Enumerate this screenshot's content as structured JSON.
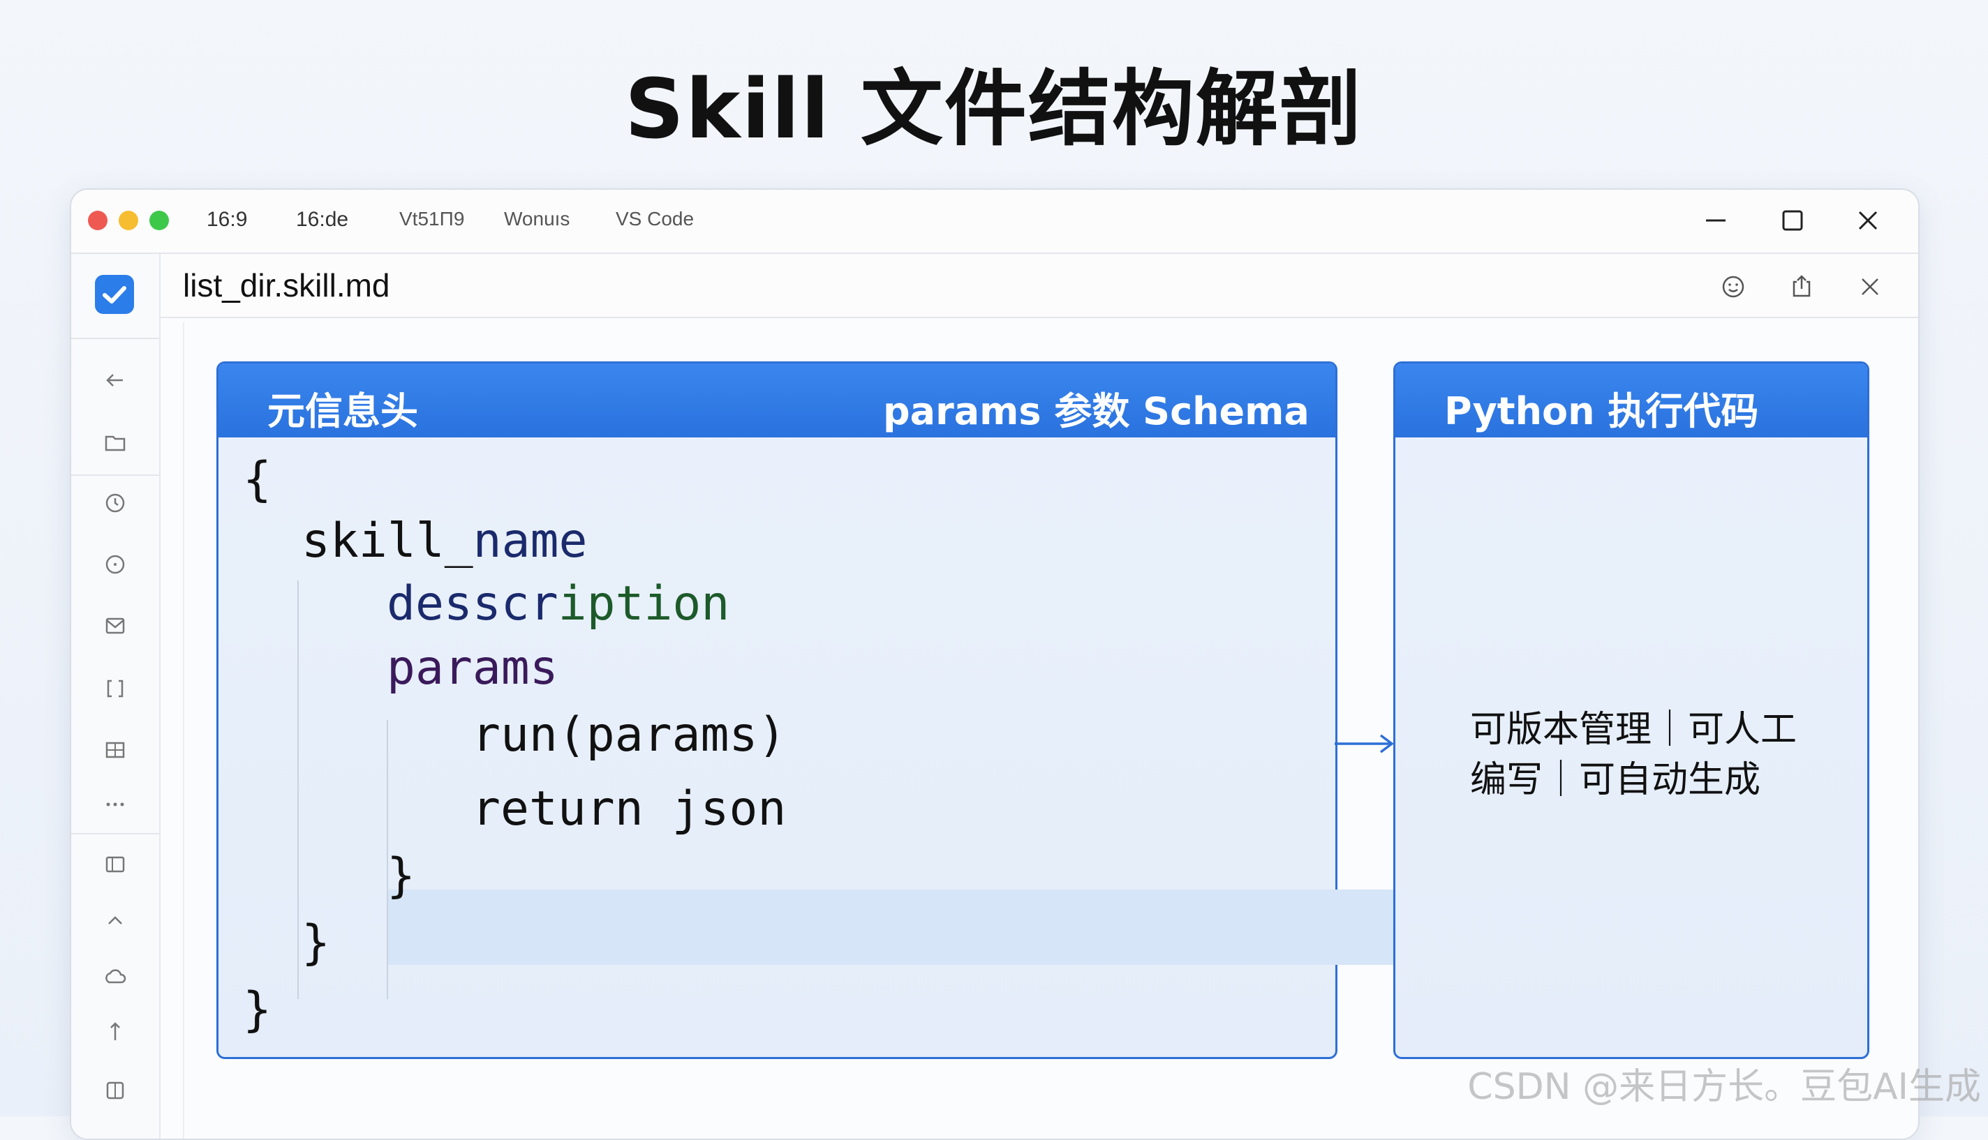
{
  "page": {
    "title": "Skill 文件结构解剖",
    "watermark": "CSDN @来日方长。豆包AI生成"
  },
  "titlebar": {
    "tabs": [
      "16:9",
      "16:de",
      "Vt51Π9",
      "Wonuıs",
      "VS Code"
    ]
  },
  "editor": {
    "file_name": "list_dir.skill.md"
  },
  "left_panel": {
    "header_left": "元信息头",
    "header_right": "params 参数 Schema",
    "code_lines": {
      "l1": "{",
      "l2a": "skill_",
      "l2b": "name",
      "l3a": "desscr",
      "l3b": "iption",
      "l4": "params",
      "l5": "run(params)",
      "l6": "return json",
      "l7": "}",
      "l8": "}",
      "l9": "}"
    }
  },
  "right_panel": {
    "header": "Python 执行代码",
    "body_line1": "可版本管理｜可人工",
    "body_line2": "编写｜可自动生成"
  },
  "colors": {
    "accent": "#2d6fd6",
    "header_blue": "#3a86ee",
    "panel_bg": "#e8f0fb",
    "highlight_row": "#d6e5f7"
  },
  "icons": {
    "sidebar": [
      "checkmark-logo-icon",
      "back-arrow-icon",
      "folder-icon",
      "clock-icon",
      "circle-icon",
      "mail-icon",
      "bracket-icon",
      "table-icon",
      "more-dots-icon",
      "panel-icon",
      "chevron-up-icon",
      "cloud-icon",
      "sort-icon",
      "split-view-icon"
    ],
    "header": [
      "emoji-icon",
      "share-icon",
      "close-icon"
    ],
    "window": [
      "minimize-icon",
      "maximize-icon",
      "close-icon"
    ]
  }
}
